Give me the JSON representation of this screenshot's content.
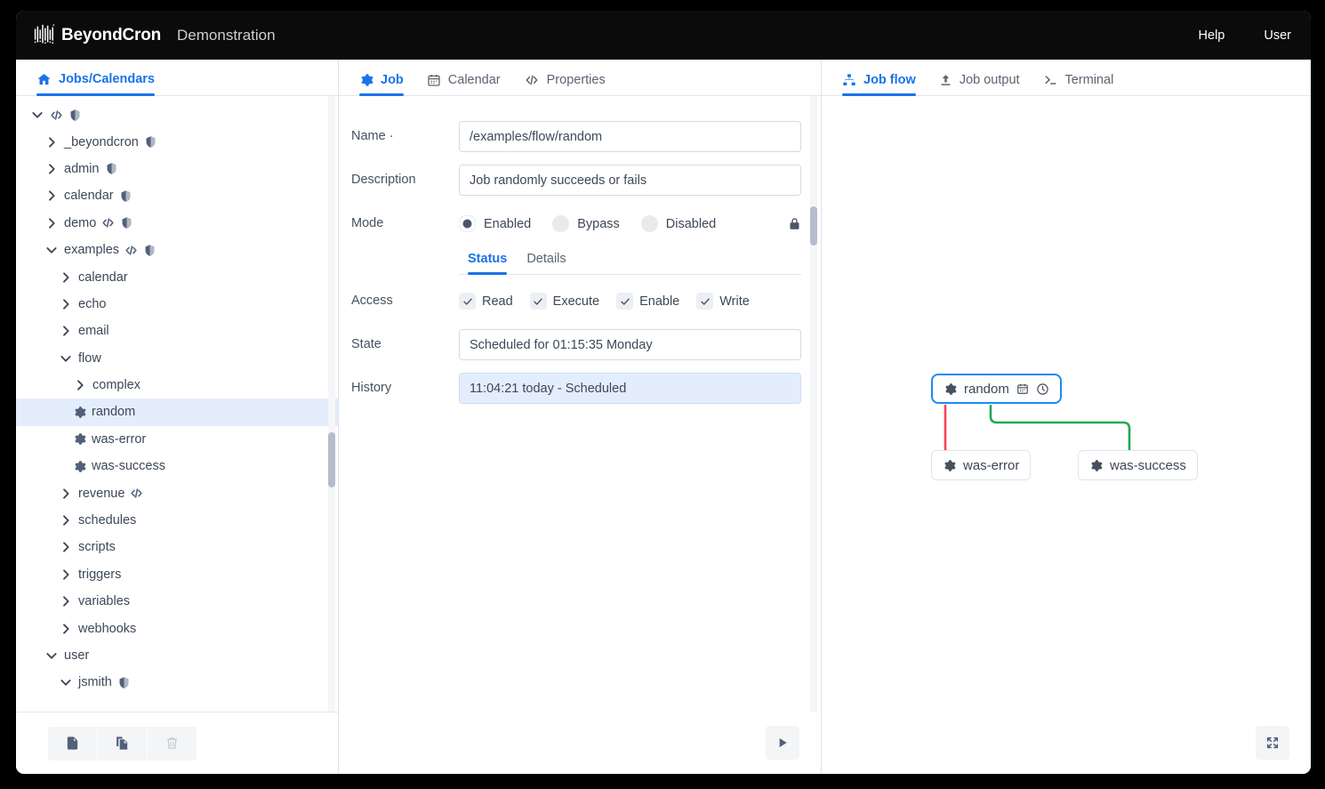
{
  "header": {
    "brand": "BeyondCron",
    "subtitle": "Demonstration",
    "help_label": "Help",
    "user_label": "User"
  },
  "sidebar": {
    "tab_label": "Jobs/Calendars",
    "tree": [
      {
        "label": "",
        "depth": 0,
        "state": "expanded",
        "icons": [
          "code",
          "shield"
        ],
        "type": "folder"
      },
      {
        "label": "_beyondcron",
        "depth": 1,
        "state": "collapsed",
        "icons": [
          "shield"
        ],
        "type": "folder"
      },
      {
        "label": "admin",
        "depth": 1,
        "state": "collapsed",
        "icons": [
          "shield"
        ],
        "type": "folder"
      },
      {
        "label": "calendar",
        "depth": 1,
        "state": "collapsed",
        "icons": [
          "shield"
        ],
        "type": "folder"
      },
      {
        "label": "demo",
        "depth": 1,
        "state": "collapsed",
        "icons": [
          "code",
          "shield"
        ],
        "type": "folder"
      },
      {
        "label": "examples",
        "depth": 1,
        "state": "expanded",
        "icons": [
          "code",
          "shield"
        ],
        "type": "folder"
      },
      {
        "label": "calendar",
        "depth": 2,
        "state": "collapsed",
        "icons": [],
        "type": "folder"
      },
      {
        "label": "echo",
        "depth": 2,
        "state": "collapsed",
        "icons": [],
        "type": "folder"
      },
      {
        "label": "email",
        "depth": 2,
        "state": "collapsed",
        "icons": [],
        "type": "folder"
      },
      {
        "label": "flow",
        "depth": 2,
        "state": "expanded",
        "icons": [],
        "type": "folder"
      },
      {
        "label": "complex",
        "depth": 3,
        "state": "collapsed",
        "icons": [],
        "type": "folder"
      },
      {
        "label": "random",
        "depth": 3,
        "state": "leaf",
        "icons": [],
        "type": "job",
        "selected": true
      },
      {
        "label": "was-error",
        "depth": 3,
        "state": "leaf",
        "icons": [],
        "type": "job"
      },
      {
        "label": "was-success",
        "depth": 3,
        "state": "leaf",
        "icons": [],
        "type": "job"
      },
      {
        "label": "revenue",
        "depth": 2,
        "state": "collapsed",
        "icons": [
          "code"
        ],
        "type": "folder"
      },
      {
        "label": "schedules",
        "depth": 2,
        "state": "collapsed",
        "icons": [],
        "type": "folder"
      },
      {
        "label": "scripts",
        "depth": 2,
        "state": "collapsed",
        "icons": [],
        "type": "folder"
      },
      {
        "label": "triggers",
        "depth": 2,
        "state": "collapsed",
        "icons": [],
        "type": "folder"
      },
      {
        "label": "variables",
        "depth": 2,
        "state": "collapsed",
        "icons": [],
        "type": "folder"
      },
      {
        "label": "webhooks",
        "depth": 2,
        "state": "collapsed",
        "icons": [],
        "type": "folder"
      },
      {
        "label": "user",
        "depth": 1,
        "state": "expanded",
        "icons": [],
        "type": "folder"
      },
      {
        "label": "jsmith",
        "depth": 2,
        "state": "expanded",
        "icons": [
          "shield"
        ],
        "type": "folder"
      }
    ],
    "toolbar": [
      {
        "name": "new-file",
        "enabled": true
      },
      {
        "name": "copy",
        "enabled": true
      },
      {
        "name": "delete",
        "enabled": false
      }
    ]
  },
  "center": {
    "tabs": [
      {
        "label": "Job",
        "icon": "gear-icon",
        "active": true
      },
      {
        "label": "Calendar",
        "icon": "calendar-icon",
        "active": false
      },
      {
        "label": "Properties",
        "icon": "code-icon",
        "active": false
      }
    ],
    "fields": {
      "name_label": "Name ·",
      "name_value": "/examples/flow/random",
      "description_label": "Description",
      "description_value": "Job randomly succeeds or fails",
      "mode_label": "Mode",
      "state_label": "State",
      "state_value": "Scheduled for 01:15:35 Monday",
      "history_label": "History",
      "history_value": "11:04:21 today - Scheduled",
      "access_label": "Access"
    },
    "mode_options": [
      {
        "label": "Enabled",
        "selected": true
      },
      {
        "label": "Bypass",
        "selected": false
      },
      {
        "label": "Disabled",
        "selected": false
      }
    ],
    "subtabs": [
      {
        "label": "Status",
        "active": true
      },
      {
        "label": "Details",
        "active": false
      }
    ],
    "access_options": [
      {
        "label": "Read",
        "checked": true
      },
      {
        "label": "Execute",
        "checked": true
      },
      {
        "label": "Enable",
        "checked": true
      },
      {
        "label": "Write",
        "checked": true
      }
    ],
    "run_button": "run-job-button"
  },
  "right": {
    "tabs": [
      {
        "label": "Job flow",
        "icon": "sitemap-icon",
        "active": true
      },
      {
        "label": "Job output",
        "icon": "upload-icon",
        "active": false
      },
      {
        "label": "Terminal",
        "icon": "terminal-icon",
        "active": false
      }
    ],
    "flow": {
      "nodes": [
        {
          "id": "random",
          "label": "random",
          "selected": true,
          "icons": [
            "gear-icon",
            "calendar-icon",
            "clock-icon"
          ]
        },
        {
          "id": "was-error",
          "label": "was-error",
          "selected": false,
          "icons": [
            "gear-icon"
          ]
        },
        {
          "id": "was-success",
          "label": "was-success",
          "selected": false,
          "icons": [
            "gear-icon"
          ]
        }
      ],
      "edges": [
        {
          "from": "random",
          "to": "was-error",
          "color": "#f4445a"
        },
        {
          "from": "random",
          "to": "was-success",
          "color": "#1faa56"
        }
      ]
    },
    "expand_button": "expand-flow-button"
  },
  "colors": {
    "accent": "#1a73e8",
    "node_selected_border": "#1a8cf0",
    "error_edge": "#f4445a",
    "success_edge": "#1faa56",
    "topbar_bg": "#0b0b0b"
  }
}
